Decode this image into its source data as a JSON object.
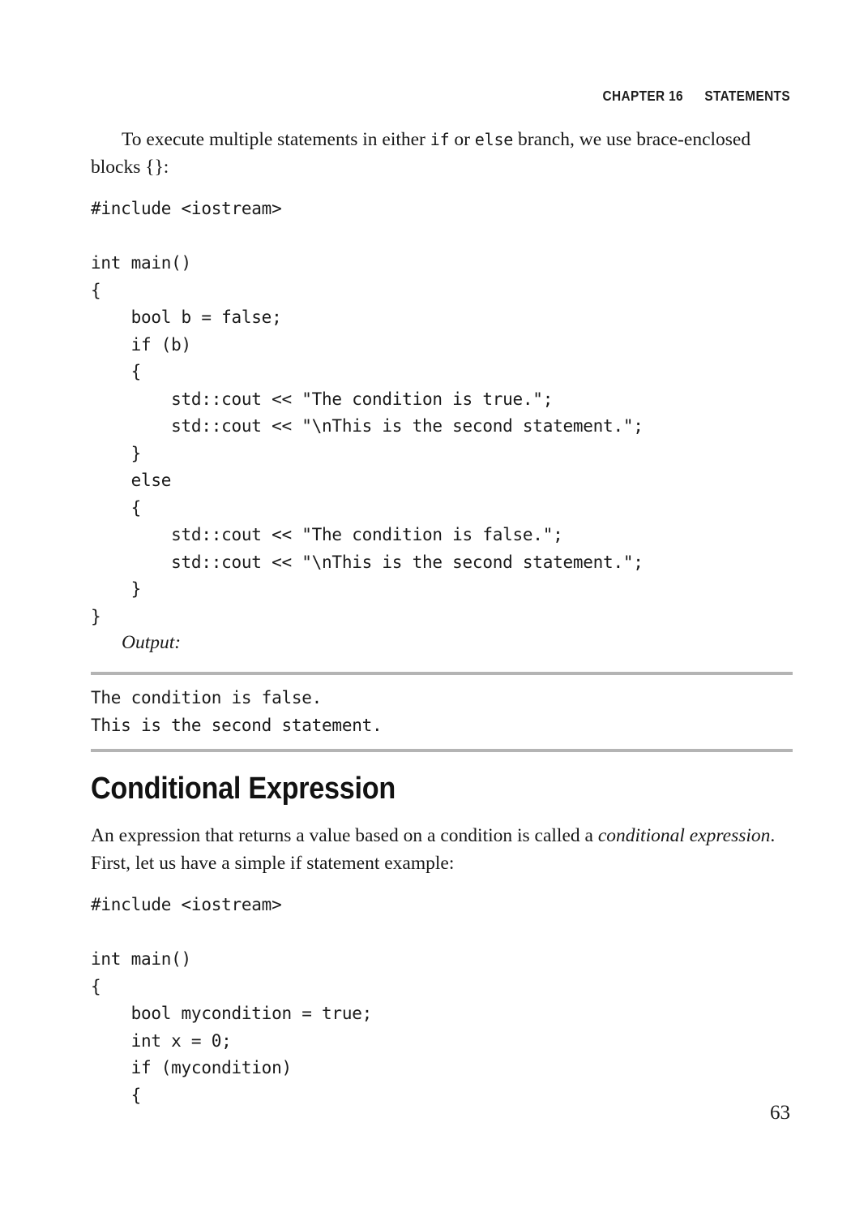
{
  "running_head": {
    "chapter": "CHAPTER 16",
    "title": "STATEMENTS"
  },
  "intro_paragraph": {
    "part1": "To execute multiple statements in either ",
    "code1": "if",
    "part2": " or ",
    "code2": "else",
    "part3": " branch, we use brace-enclosed blocks {}:"
  },
  "code_block_1": "#include <iostream>\n\nint main()\n{\n    bool b = false;\n    if (b)\n    {\n        std::cout << \"The condition is true.\";\n        std::cout << \"\\nThis is the second statement.\";\n    }\n    else\n    {\n        std::cout << \"The condition is false.\";\n        std::cout << \"\\nThis is the second statement.\";\n    }\n}",
  "output_block": {
    "label": "Output:",
    "text": "The condition is false.\nThis is the second statement."
  },
  "section_heading": "Conditional Expression",
  "section_paragraph": {
    "part1": "An expression that returns a value based on a condition is called a ",
    "italic1": "conditional expression",
    "part2": ". First, let us have a simple if statement example:"
  },
  "code_block_2": "#include <iostream>\n\nint main()\n{\n    bool mycondition = true;\n    int x = 0;\n    if (mycondition)\n    {",
  "page_number": "63",
  "colors": {
    "rule": "#b4b4b4",
    "text": "#1a1a1a",
    "background": "#ffffff"
  }
}
